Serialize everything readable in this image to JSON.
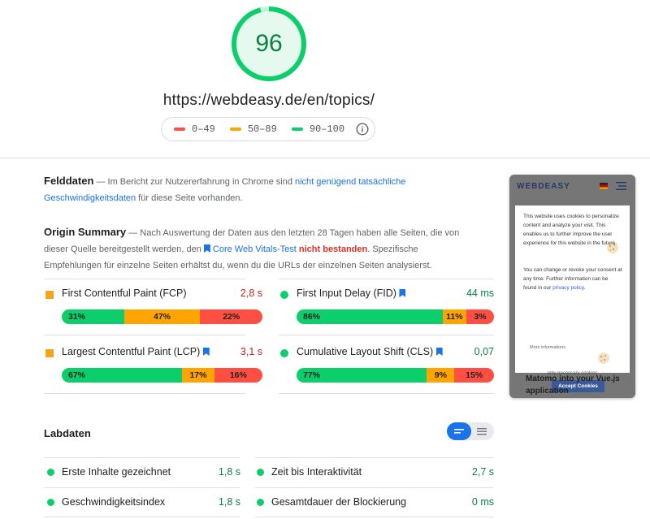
{
  "header": {
    "score": "96",
    "url": "https://webdeasy.de/en/topics/",
    "legend": [
      {
        "label": "0–49",
        "color": "#ff4e42"
      },
      {
        "label": "50–89",
        "color": "#ffa400"
      },
      {
        "label": "90–100",
        "color": "#0cce6b"
      }
    ],
    "info_icon": "info-icon"
  },
  "field": {
    "title": "Felddaten",
    "text1": " — Im Bericht zur Nutzererfahrung in Chrome sind ",
    "link": "nicht genügend tatsächliche Geschwindigkeitsdaten",
    "text2": " für diese Seite vorhanden."
  },
  "origin": {
    "title": "Origin Summary",
    "text1": " — Nach Auswertung der Daten aus den letzten 28 Tagen haben alle Seiten, die von dieser Quelle bereitgestellt werden, den ",
    "link": "Core Web Vitals-Test",
    "fail": "nicht bestanden",
    "text2": ". Spezifische Empfehlungen für einzelne Seiten erhältst du, wenn du die URLs der einzelnen Seiten analysierst."
  },
  "metrics": [
    {
      "name": "First Contentful Paint (FCP)",
      "value": "2,8 s",
      "status_color": "#f4a41a",
      "value_color": "#c5221f",
      "good": "31%",
      "avg": "47%",
      "poor": "22%",
      "good_pct": 31,
      "avg_pct": 47,
      "poor_pct": 22
    },
    {
      "name": "First Input Delay (FID)",
      "value": "44 ms",
      "status_color": "#0cce6b",
      "value_color": "#0b8043",
      "good": "86%",
      "avg": "11%",
      "poor": "3%",
      "good_pct": 86,
      "avg_pct": 11,
      "poor_pct": 3
    },
    {
      "name": "Largest Contentful Paint (LCP)",
      "value": "3,1 s",
      "status_color": "#f4a41a",
      "value_color": "#c5221f",
      "good": "67%",
      "avg": "17%",
      "poor": "16%",
      "good_pct": 67,
      "avg_pct": 17,
      "poor_pct": 16
    },
    {
      "name": "Cumulative Layout Shift (CLS)",
      "value": "0,07",
      "status_color": "#0cce6b",
      "value_color": "#0b8043",
      "good": "77%",
      "avg": "9%",
      "poor": "15%",
      "good_pct": 77,
      "avg_pct": 9,
      "poor_pct": 15
    }
  ],
  "lab": {
    "title": "Labdaten",
    "rows": [
      {
        "name": "Erste Inhalte gezeichnet",
        "value": "1,8 s"
      },
      {
        "name": "Zeit bis Interaktivität",
        "value": "2,7 s"
      },
      {
        "name": "Geschwindigkeitsindex",
        "value": "1,8 s"
      },
      {
        "name": "Gesamtdauer der Blockierung",
        "value": "0 ms"
      }
    ]
  },
  "screenshot": {
    "logo": "WEBDEASY",
    "cookie_text1": "This website uses cookies to personalize content and analyze your visit. This enables us to further improve the user experience for this website in the future.",
    "cookie_text2a": "You can change or revoke your consent at any time. Further information can be found in our ",
    "cookie_link": "privacy policy",
    "cookie_text2b": ".",
    "more_info": "More informations",
    "only_necessary": "only necessary cookies",
    "accept": "Accept Cookies",
    "article": "Matomo into your Vue.js application"
  },
  "colors": {
    "good": "#0cce6b",
    "average": "#ffa400",
    "poor": "#ff4e42",
    "accent": "#1a73e8"
  }
}
